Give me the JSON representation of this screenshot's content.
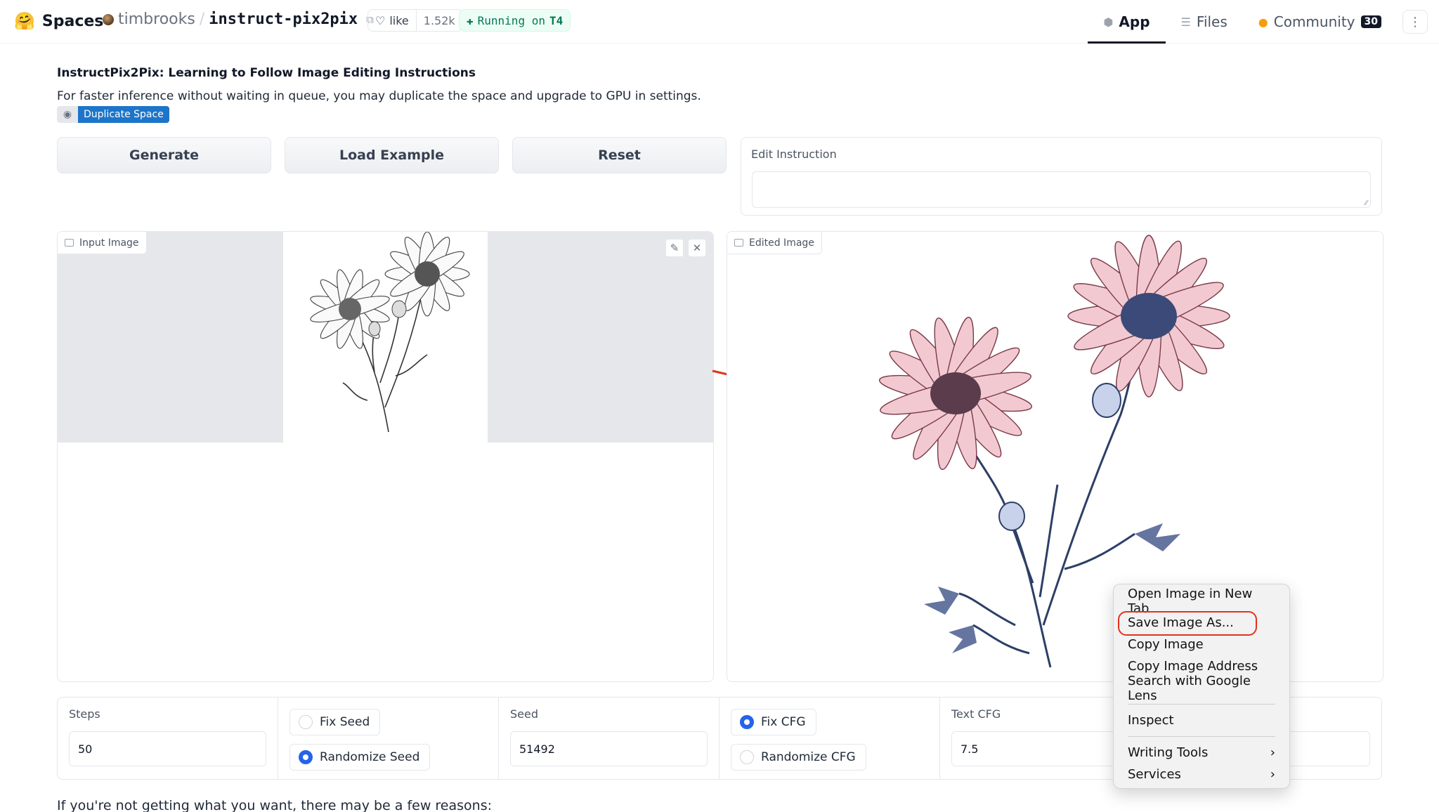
{
  "header": {
    "brand_emoji": "🤗",
    "brand_name": "Spaces",
    "owner": "timbrooks",
    "separator": "/",
    "repo": "instruct-pix2pix",
    "like_label": "like",
    "like_count": "1.52k",
    "status_prefix": "Running on",
    "status_hw": "T4",
    "tabs": [
      {
        "label": "App",
        "icon": "cube-icon"
      },
      {
        "label": "Files",
        "icon": "files-icon"
      },
      {
        "label": "Community",
        "icon": "community-icon",
        "badge": "30"
      }
    ]
  },
  "page": {
    "title": "InstructPix2Pix: Learning to Follow Image Editing Instructions",
    "subtitle": "For faster inference without waiting in queue, you may duplicate the space and upgrade to GPU in settings.",
    "duplicate_label": "Duplicate Space"
  },
  "buttons": {
    "generate": "Generate",
    "load_example": "Load Example",
    "reset": "Reset"
  },
  "edit_instruction": {
    "label": "Edit Instruction",
    "value": ""
  },
  "images": {
    "input_label": "Input Image",
    "output_label": "Edited Image"
  },
  "controls": {
    "steps_label": "Steps",
    "steps_value": "50",
    "fix_seed": "Fix Seed",
    "randomize_seed": "Randomize Seed",
    "seed_label": "Seed",
    "seed_value": "51492",
    "fix_cfg": "Fix CFG",
    "randomize_cfg": "Randomize CFG",
    "text_cfg_label": "Text CFG",
    "text_cfg_value": "7.5"
  },
  "footer_text": "If you're not getting what you want, there may be a few reasons:",
  "context_menu": {
    "items": [
      "Open Image in New Tab",
      "Save Image As...",
      "Copy Image",
      "Copy Image Address",
      "Search with Google Lens",
      "Inspect",
      "Writing Tools",
      "Services"
    ],
    "highlighted": "Save Image As..."
  },
  "colors": {
    "accent_blue": "#2563eb",
    "duplicate_blue": "#1d75c9",
    "running_green": "#047857",
    "annotation_red": "#e0331c"
  }
}
